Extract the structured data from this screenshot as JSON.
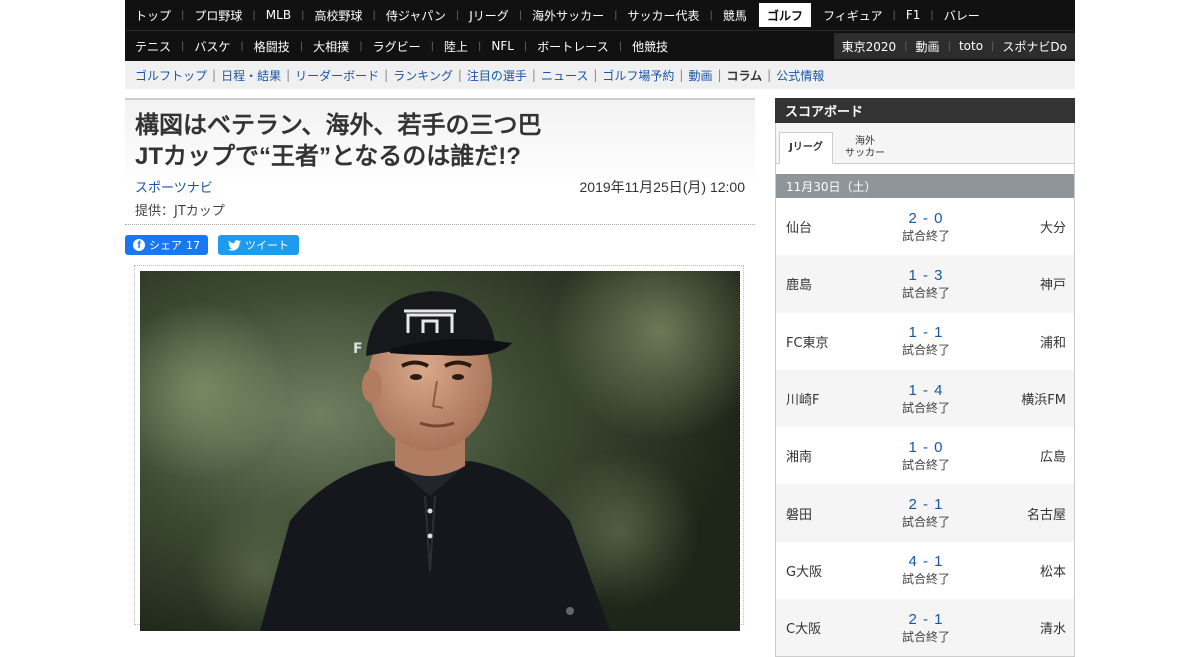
{
  "nav": {
    "row1": [
      "トップ",
      "プロ野球",
      "MLB",
      "高校野球",
      "侍ジャパン",
      "Jリーグ",
      "海外サッカー",
      "サッカー代表",
      "競馬",
      "ゴルフ",
      "フィギュア",
      "F1",
      "バレー"
    ],
    "active": "ゴルフ",
    "row2": [
      "テニス",
      "バスケ",
      "格闘技",
      "大相撲",
      "ラグビー",
      "陸上",
      "NFL",
      "ボートレース",
      "他競技"
    ],
    "row2_right": [
      "東京2020",
      "動画",
      "toto",
      "スポナビDo"
    ]
  },
  "subnav": {
    "items": [
      "ゴルフトップ",
      "日程・結果",
      "リーダーボード",
      "ランキング",
      "注目の選手",
      "ニュース",
      "ゴルフ場予約",
      "動画",
      "コラム",
      "公式情報"
    ],
    "current": "コラム"
  },
  "article": {
    "title_line1": "構図はベテラン、海外、若手の三つ巴",
    "title_line2": "JTカップで“王者”となるのは誰だ!?",
    "author": "スポーツナビ",
    "date": "2019年11月25日(月) 12:00",
    "provider": "提供：JTカップ"
  },
  "share": {
    "facebook_label": "シェア",
    "facebook_count": "17",
    "twitter_label": "ツイート"
  },
  "scoreboard": {
    "title": "スコアボード",
    "tabs": [
      {
        "label": "Jリーグ",
        "active": true
      },
      {
        "label": "海外\nサッカー",
        "active": false
      }
    ],
    "date": "11月30日（土）",
    "matches": [
      {
        "home": "仙台",
        "score": "2 - 0",
        "status": "試合終了",
        "away": "大分"
      },
      {
        "home": "鹿島",
        "score": "1 - 3",
        "status": "試合終了",
        "away": "神戸"
      },
      {
        "home": "FC東京",
        "score": "1 - 1",
        "status": "試合終了",
        "away": "浦和"
      },
      {
        "home": "川崎F",
        "score": "1 - 4",
        "status": "試合終了",
        "away": "横浜FM"
      },
      {
        "home": "湘南",
        "score": "1 - 0",
        "status": "試合終了",
        "away": "広島"
      },
      {
        "home": "磐田",
        "score": "2 - 1",
        "status": "試合終了",
        "away": "名古屋"
      },
      {
        "home": "G大阪",
        "score": "4 - 1",
        "status": "試合終了",
        "away": "松本"
      },
      {
        "home": "C大阪",
        "score": "2 - 1",
        "status": "試合終了",
        "away": "清水"
      }
    ]
  },
  "colors": {
    "nav_bg": "#111111",
    "link": "#1a56a8",
    "facebook": "#1877f2",
    "twitter": "#1d9bf0",
    "date_bar": "#8e959b"
  }
}
